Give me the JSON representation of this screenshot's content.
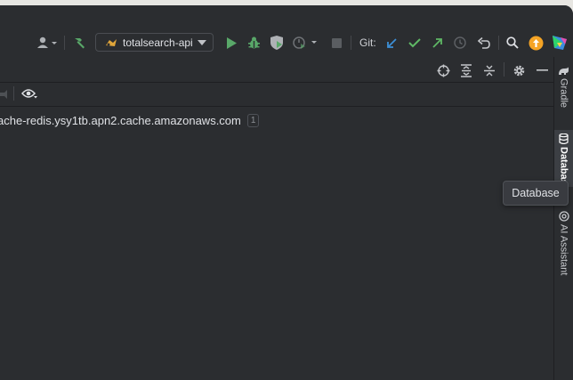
{
  "toolbar": {
    "run_config": {
      "label": "totalsearch-api"
    },
    "git_label": "Git:",
    "icons": [
      "user-icon",
      "build-hammer-icon",
      "run-icon",
      "debug-icon",
      "coverage-icon",
      "profile-icon",
      "stop-icon",
      "git-update-icon",
      "git-commit-icon",
      "git-push-icon",
      "history-icon",
      "rollback-icon",
      "search-icon",
      "update-icon",
      "jetbrains-logo-icon"
    ]
  },
  "panel": {
    "header_icons": [
      "locate-icon",
      "expand-all-icon",
      "collapse-all-icon",
      "settings-icon",
      "hide-icon"
    ],
    "tools_icons": [
      "pin-icon",
      "view-icon"
    ],
    "tree": [
      {
        "label": "ache-redis.ysy1tb.apn2.cache.amazonaws.com",
        "badge": "1"
      }
    ]
  },
  "stripe": {
    "items": [
      {
        "label": "Gradle",
        "icon": "gradle-icon"
      },
      {
        "label": "Databas",
        "icon": "database-icon",
        "active": true
      },
      {
        "label": "AI Assistant",
        "icon": "ai-assistant-icon"
      }
    ]
  },
  "tooltip": {
    "text": "Database"
  },
  "colors": {
    "background": "#2b2d30",
    "run_green": "#59a869",
    "git_blue": "#3d8fd6",
    "git_green": "#5fb865",
    "update_orange": "#f5a425"
  }
}
